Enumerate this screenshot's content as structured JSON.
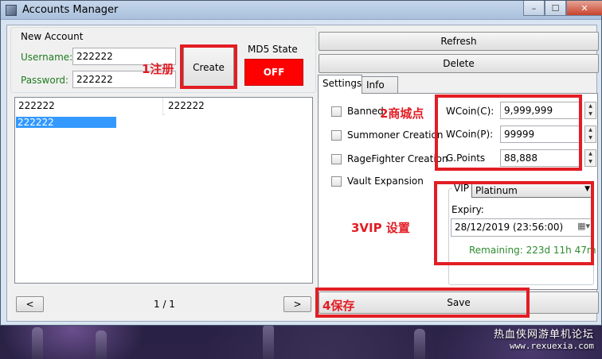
{
  "window": {
    "title": "Accounts Manager",
    "controls": {
      "minimize": "–",
      "maximize": "☐",
      "close": "✕"
    }
  },
  "new_account": {
    "group_label": "New Account",
    "username_label": "Username:",
    "username_value": "222222",
    "password_label": "Password:",
    "password_value": "222222",
    "create_label": "Create"
  },
  "md5": {
    "label": "MD5 State",
    "value": "OFF",
    "color": "#ff0000"
  },
  "search": {
    "field1": "222222",
    "field2": "222222"
  },
  "accounts_list": {
    "items": [
      "222222"
    ]
  },
  "pager": {
    "prev": "<",
    "next": ">",
    "page": "1 / 1"
  },
  "toolbar": {
    "refresh": "Refresh",
    "delete": "Delete",
    "save": "Save"
  },
  "tabs": [
    {
      "label": "Settings",
      "active": true
    },
    {
      "label": "Info",
      "active": false
    }
  ],
  "settings": {
    "checkboxes": [
      {
        "label": "Banned",
        "checked": false
      },
      {
        "label": "Summoner Creation",
        "checked": false
      },
      {
        "label": "RageFighter Creation",
        "checked": false
      },
      {
        "label": "Vault Expansion",
        "checked": false
      }
    ],
    "wcoin_c_label": "WCoin(C):",
    "wcoin_c_value": "9,999,999",
    "wcoin_p_label": "WCoin(P):",
    "wcoin_p_value": "99999",
    "gpoints_label": "G.Points",
    "gpoints_value": "88,888",
    "vip": {
      "group_label": "VIP",
      "selected": "Platinum",
      "expiry_label": "Expiry:",
      "expiry_value": "28/12/2019 (23:56:00)",
      "remaining": "Remaining: 223d 11h 47m",
      "remaining_color": "#2e8b2e"
    }
  },
  "annotations": {
    "create": "1注册",
    "shop": "2商城点",
    "vip": "3VIP 设置",
    "save": "4保存",
    "color": "#e21d24"
  },
  "watermark": {
    "line1": "热血侠网游单机论坛",
    "line2": "www.rexuexia.com"
  }
}
